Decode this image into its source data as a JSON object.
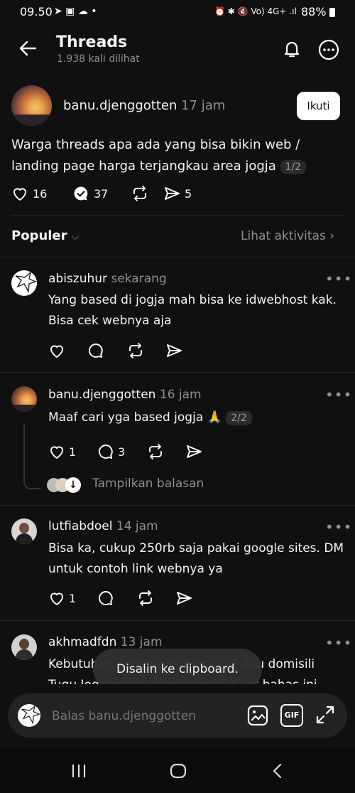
{
  "status": {
    "time": "09.50",
    "battery": "88%"
  },
  "header": {
    "title": "Threads",
    "views": "1.938 kali dilihat"
  },
  "post": {
    "username": "banu.djenggotten",
    "time": "17 jam",
    "follow_label": "Ikuti",
    "text_line1": "Warga threads apa ada yang bisa bikin web /",
    "text_line2": "landing page harga terjangkau area jogja",
    "page_chip": "1/2",
    "likes": "16",
    "replies": "37",
    "shares": "5"
  },
  "sort": {
    "label": "Populer",
    "activity": "Lihat aktivitas"
  },
  "comments": [
    {
      "username": "abiszuhur",
      "time": "sekarang",
      "line1": "Yang based di jogja mah bisa ke idwebhost kak.",
      "line2": "Bisa cek webnya aja"
    },
    {
      "username": "banu.djenggotten",
      "time": "16 jam",
      "line1": "Maaf cari yga based jogja 🙏",
      "chip": "2/2",
      "likes": "1",
      "replies": "3",
      "show_replies": "Tampilkan balasan"
    },
    {
      "username": "lutfiabdoel",
      "time": "14 jam",
      "line1": "Bisa ka, cukup 250rb saja pakai google sites. DM",
      "line2": "untuk contoh link webnya ya",
      "likes": "1"
    },
    {
      "username": "akhmadfdn",
      "time": "13 jam",
      "line1": "Kebutuhan webnya gimana ka? Aku domisili",
      "line2": "Tugu Jogja.. bisa sambil ngopi buat bahas ini"
    }
  ],
  "toast": "Disalin ke clipboard.",
  "reply_bar": {
    "placeholder": "Balas banu.djenggotten",
    "gif_label": "GIF"
  }
}
